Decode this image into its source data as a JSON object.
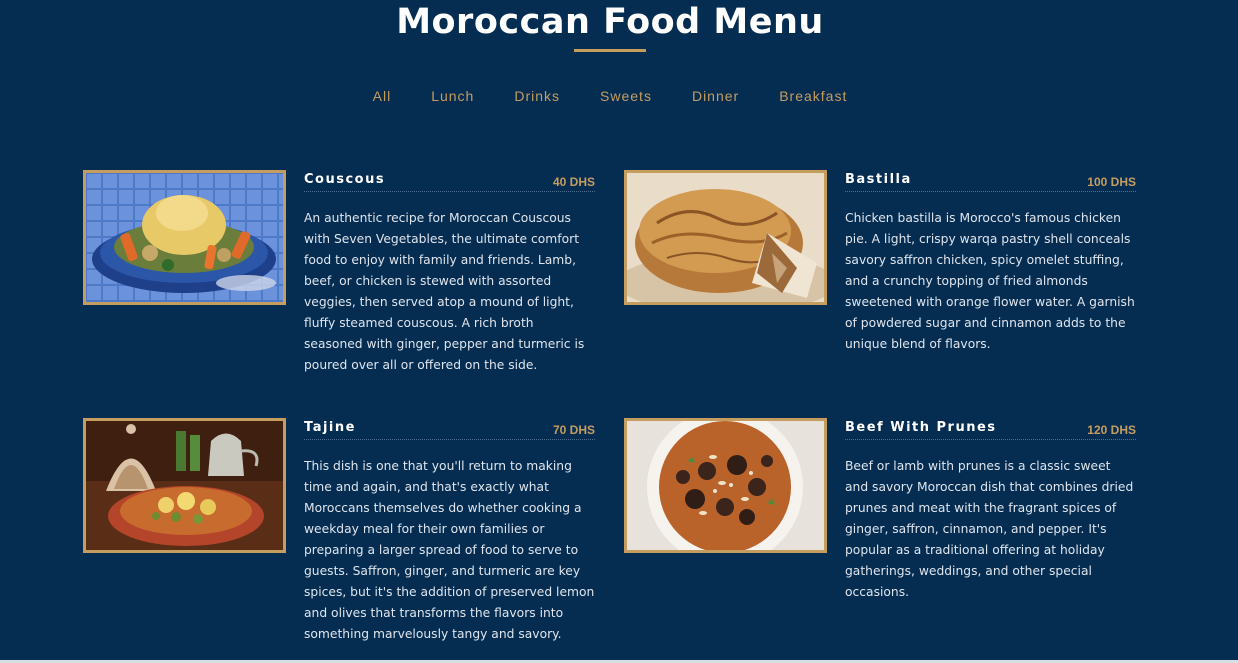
{
  "page": {
    "title": "Moroccan Food Menu"
  },
  "colors": {
    "background": "#052d52",
    "accent": "#c59d5f",
    "text": "#ffffff"
  },
  "filters": [
    "All",
    "Lunch",
    "Drinks",
    "Sweets",
    "Dinner",
    "Breakfast"
  ],
  "items": [
    {
      "name": "Couscous",
      "price": "40 DHS",
      "photo": "couscous-photo",
      "desc": "An authentic recipe for Moroccan Couscous with Seven Vegetables, the ultimate comfort food to enjoy with family and friends. Lamb, beef, or chicken is stewed with assorted veggies, then served atop a mound of light, fluffy steamed couscous. A rich broth seasoned with ginger, pepper and turmeric is poured over all or offered on the side."
    },
    {
      "name": "Bastilla",
      "price": "100 DHS",
      "photo": "bastilla-photo",
      "desc": "Chicken bastilla is Morocco's famous chicken pie. A light, crispy warqa pastry shell conceals savory saffron chicken, spicy omelet stuffing, and a crunchy topping of fried almonds sweetened with orange flower water. A garnish of powdered sugar and cinnamon adds to the unique blend of flavors."
    },
    {
      "name": "Tajine",
      "price": "70 DHS",
      "photo": "tajine-photo",
      "desc": "This dish is one that you'll return to making time and again, and that's exactly what Moroccans themselves do whether cooking a weekday meal for their own families or preparing a larger spread of food to serve to guests. Saffron, ginger, and turmeric are key spices, but it's the addition of preserved lemon and olives that transforms the flavors into something marvelously tangy and savory."
    },
    {
      "name": "Beef With Prunes",
      "price": "120 DHS",
      "photo": "beef-prunes-photo",
      "desc": "Beef or lamb with prunes is a classic sweet and savory Moroccan dish that combines dried prunes and meat with the fragrant spices of ginger, saffron, cinnamon, and pepper. It's popular as a traditional offering at holiday gatherings, weddings, and other special occasions."
    }
  ]
}
